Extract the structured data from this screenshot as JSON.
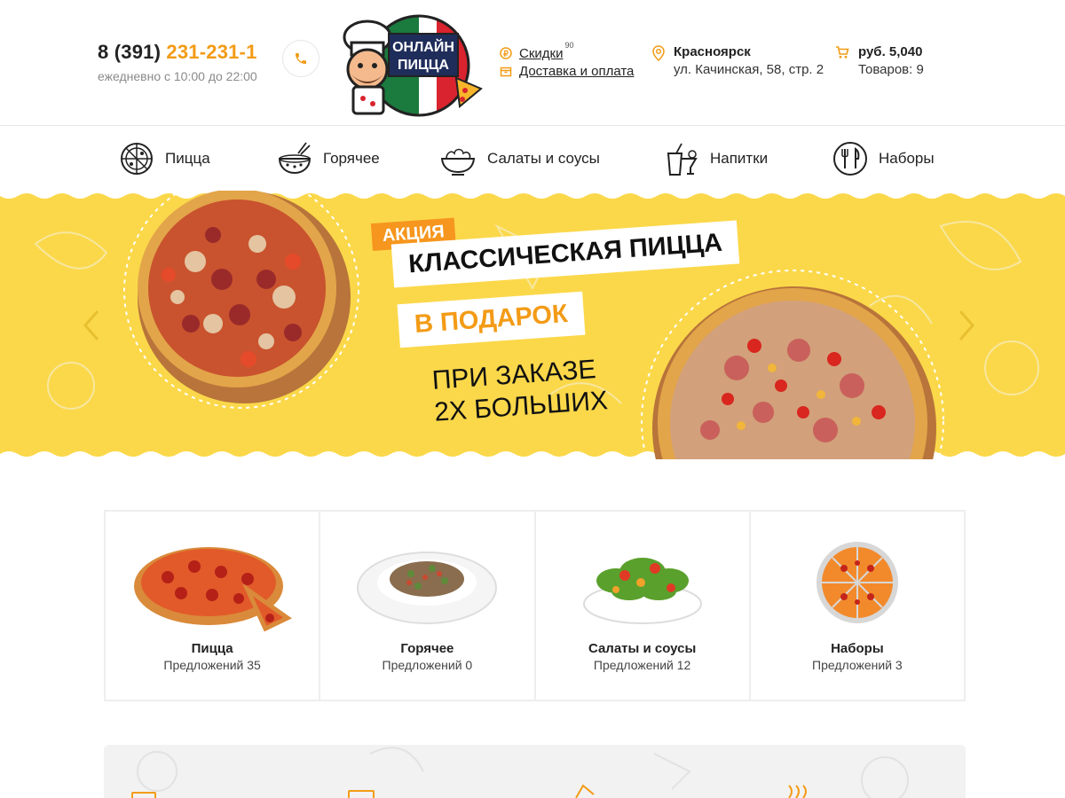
{
  "header": {
    "phone_prefix": "8 (391)",
    "phone_number": "231-231-1",
    "hours": "ежедневно с 10:00 до 22:00",
    "call_icon": "phone-icon",
    "logo": {
      "line1": "ОНЛАЙН",
      "line2": "ПИЦЦА"
    },
    "links": [
      {
        "label": "Скидки",
        "badge": "90",
        "icon": "ruble-coin-icon"
      },
      {
        "label": "Доставка и оплата",
        "icon": "box-icon"
      }
    ],
    "location": {
      "city": "Красноярск",
      "address": "ул. Качинская, 58, стр. 2",
      "icon": "map-pin-icon"
    },
    "cart": {
      "total": "руб. 5,040",
      "items": "Товаров: 9",
      "icon": "cart-icon"
    }
  },
  "nav": {
    "items": [
      {
        "label": "Пицца",
        "icon": "pizza-icon"
      },
      {
        "label": "Горячее",
        "icon": "hot-bowl-icon"
      },
      {
        "label": "Салаты и соусы",
        "icon": "salad-bowl-icon"
      },
      {
        "label": "Напитки",
        "icon": "drinks-icon"
      },
      {
        "label": "Наборы",
        "icon": "plate-cutlery-icon"
      }
    ]
  },
  "banner": {
    "tag": "АКЦИЯ",
    "title": "КЛАССИЧЕСКАЯ ПИЦЦА",
    "gift": "В ПОДАРОК",
    "sub_line1": "ПРИ ЗАКАЗЕ",
    "sub_line2": "2Х БОЛЬШИХ",
    "prev_icon": "chevron-left-icon",
    "next_icon": "chevron-right-icon"
  },
  "categories": [
    {
      "name": "Пицца",
      "offers": "Предложений 35"
    },
    {
      "name": "Горячее",
      "offers": "Предложений 0"
    },
    {
      "name": "Салаты и соусы",
      "offers": "Предложений 12"
    },
    {
      "name": "Наборы",
      "offers": "Предложений 3"
    }
  ],
  "colors": {
    "accent": "#f39b16",
    "banner_yellow": "#fbd84a",
    "tag_orange": "#f6961e"
  }
}
